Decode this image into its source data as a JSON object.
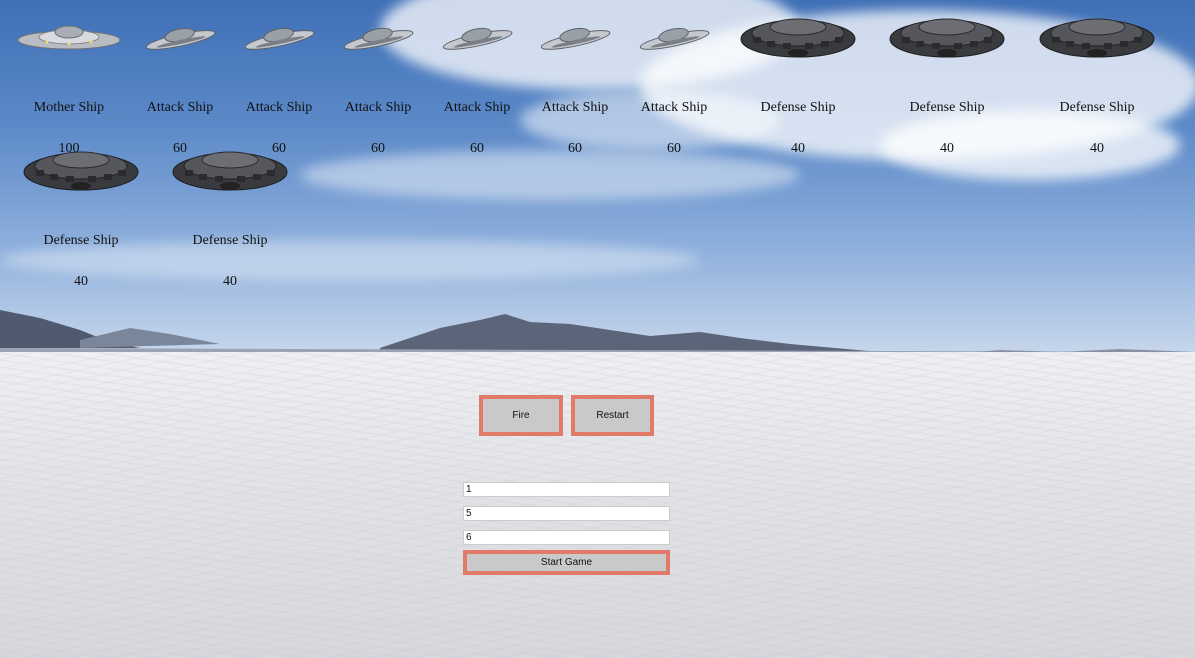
{
  "fleet": {
    "row1": [
      {
        "name": "Mother Ship",
        "hp": "100",
        "kind": "mother"
      },
      {
        "name": "Attack Ship",
        "hp": "60",
        "kind": "attack"
      },
      {
        "name": "Attack Ship",
        "hp": "60",
        "kind": "attack"
      },
      {
        "name": "Attack Ship",
        "hp": "60",
        "kind": "attack"
      },
      {
        "name": "Attack Ship",
        "hp": "60",
        "kind": "attack"
      },
      {
        "name": "Attack Ship",
        "hp": "60",
        "kind": "attack"
      },
      {
        "name": "Attack Ship",
        "hp": "60",
        "kind": "attack"
      },
      {
        "name": "Defense Ship",
        "hp": "40",
        "kind": "defense"
      },
      {
        "name": "Defense Ship",
        "hp": "40",
        "kind": "defense"
      },
      {
        "name": "Defense Ship",
        "hp": "40",
        "kind": "defense"
      }
    ],
    "row2": [
      {
        "name": "Defense Ship",
        "hp": "40",
        "kind": "defense"
      },
      {
        "name": "Defense Ship",
        "hp": "40",
        "kind": "defense"
      }
    ]
  },
  "controls": {
    "fire_label": "Fire",
    "restart_label": "Restart",
    "start_label": "Start Game",
    "input_mother": "1",
    "input_attack": "5",
    "input_defense": "6"
  },
  "colors": {
    "button_border": "#e27a6a",
    "button_bg": "#c9c9c9"
  }
}
